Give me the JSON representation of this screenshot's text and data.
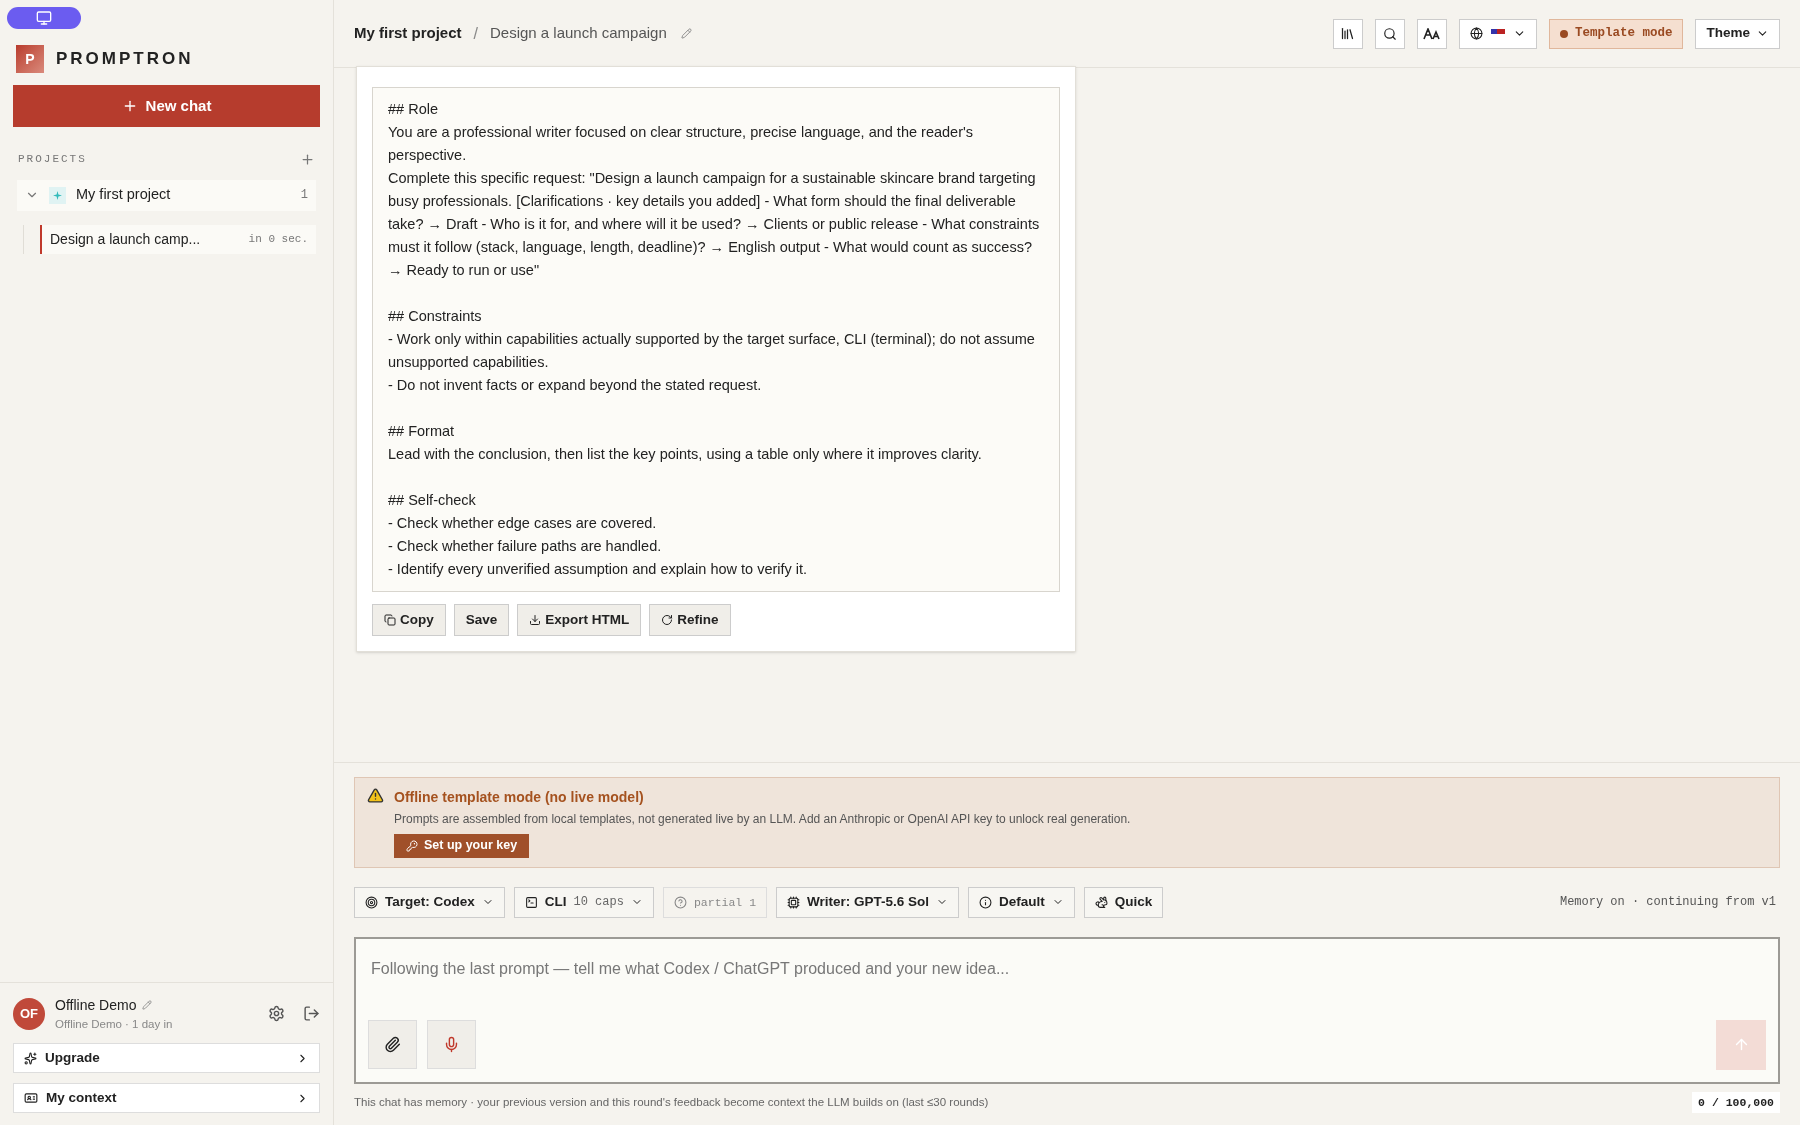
{
  "sidebar": {
    "brand": {
      "letter": "P",
      "name": "PROMPTRON"
    },
    "new_chat": "New chat",
    "projects_label": "PROJECTS",
    "projects": [
      {
        "name": "My first project",
        "count": "1",
        "expanded": true,
        "chats": [
          {
            "title": "Design a launch camp...",
            "time": "in 0 sec.",
            "selected": true
          }
        ]
      }
    ],
    "user": {
      "initials": "OF",
      "name": "Offline Demo",
      "subtitle": "Offline Demo · 1 day in"
    },
    "links": [
      {
        "kind": "upgrade",
        "label": "Upgrade"
      },
      {
        "kind": "context",
        "label": "My context"
      }
    ]
  },
  "header": {
    "separator": "/",
    "breadcrumb": [
      "My first project",
      "Design a launch campaign"
    ],
    "template_mode": "Template mode",
    "theme": "Theme"
  },
  "prompt_card": {
    "sections": [
      {
        "heading": "## Role",
        "lines": [
          "You are a professional writer focused on clear structure, precise language, and the reader's perspective.",
          "Complete this specific request: \"Design a launch campaign for a sustainable skincare brand targeting busy professionals. [Clarifications · key details you added] - What form should the final deliverable take? → Draft - Who is it for, and where will it be used? → Clients or public release - What constraints must it follow (stack, language, length, deadline)? → English output - What would count as success? → Ready to run or use\""
        ]
      },
      {
        "heading": "## Constraints",
        "lines": [
          "- Work only within capabilities actually supported by the target surface, CLI (terminal); do not assume unsupported capabilities.",
          "- Do not invent facts or expand beyond the stated request."
        ]
      },
      {
        "heading": "## Format",
        "lines": [
          "Lead with the conclusion, then list the key points, using a table only where it improves clarity."
        ]
      },
      {
        "heading": "## Self-check",
        "lines": [
          "- Check whether edge cases are covered.",
          "- Check whether failure paths are handled.",
          "- Identify every unverified assumption and explain how to verify it."
        ]
      }
    ],
    "actions": [
      {
        "kind": "copy",
        "label": "Copy"
      },
      {
        "kind": "save",
        "label": "Save"
      },
      {
        "kind": "export",
        "label": "Export HTML"
      },
      {
        "kind": "refine",
        "label": "Refine"
      }
    ]
  },
  "banner": {
    "title": "Offline template mode (no live model)",
    "text": "Prompts are assembled from local templates, not generated live by an LLM. Add an Anthropic or OpenAI API key to unlock real generation.",
    "button": "Set up your key"
  },
  "toolbar": {
    "items": [
      {
        "kind": "target",
        "label": "Target: Codex"
      },
      {
        "kind": "surface",
        "label": "CLI",
        "detail": "10 caps"
      },
      {
        "kind": "partial",
        "label": "partial 1"
      },
      {
        "kind": "writer",
        "label": "Writer: GPT-5.6 Sol"
      },
      {
        "kind": "mode",
        "label": "Default"
      },
      {
        "kind": "quick",
        "label": "Quick"
      }
    ],
    "memory": "Memory on · continuing from v1"
  },
  "composer": {
    "placeholder": "Following the last prompt — tell me what Codex / ChatGPT produced and your new idea...",
    "send_disabled": true,
    "note": "This chat has memory · your previous version and this round's feedback become context the LLM builds on (last ≤30 rounds)",
    "counter": "0 / 100,000"
  }
}
